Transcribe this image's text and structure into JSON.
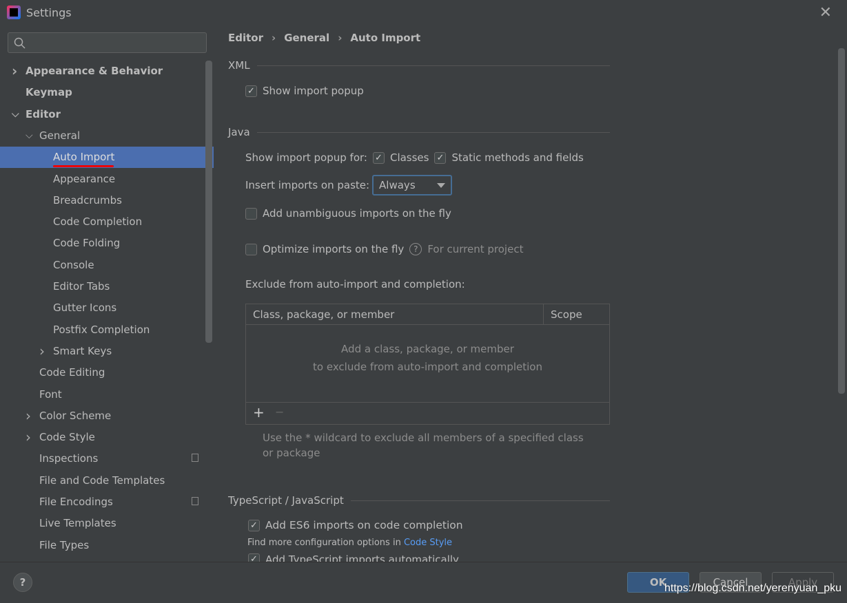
{
  "window": {
    "title": "Settings",
    "close_icon": "close-icon"
  },
  "search": {
    "placeholder": ""
  },
  "sidebar": {
    "items": [
      {
        "label": "Appearance & Behavior",
        "level": 0,
        "bold": true,
        "arrow": "right"
      },
      {
        "label": "Keymap",
        "level": 0,
        "bold": true,
        "arrow": ""
      },
      {
        "label": "Editor",
        "level": 0,
        "bold": true,
        "arrow": "down"
      },
      {
        "label": "General",
        "level": 1,
        "arrow": "down"
      },
      {
        "label": "Auto Import",
        "level": 2,
        "selected": true,
        "arrow": ""
      },
      {
        "label": "Appearance",
        "level": 2,
        "arrow": ""
      },
      {
        "label": "Breadcrumbs",
        "level": 2,
        "arrow": ""
      },
      {
        "label": "Code Completion",
        "level": 2,
        "arrow": ""
      },
      {
        "label": "Code Folding",
        "level": 2,
        "arrow": ""
      },
      {
        "label": "Console",
        "level": 2,
        "arrow": ""
      },
      {
        "label": "Editor Tabs",
        "level": 2,
        "arrow": ""
      },
      {
        "label": "Gutter Icons",
        "level": 2,
        "arrow": ""
      },
      {
        "label": "Postfix Completion",
        "level": 2,
        "arrow": ""
      },
      {
        "label": "Smart Keys",
        "level": 2,
        "arrow": "right"
      },
      {
        "label": "Code Editing",
        "level": 1,
        "arrow": ""
      },
      {
        "label": "Font",
        "level": 1,
        "arrow": ""
      },
      {
        "label": "Color Scheme",
        "level": 1,
        "arrow": "right"
      },
      {
        "label": "Code Style",
        "level": 1,
        "arrow": "right"
      },
      {
        "label": "Inspections",
        "level": 1,
        "arrow": "",
        "project_icon": true
      },
      {
        "label": "File and Code Templates",
        "level": 1,
        "arrow": ""
      },
      {
        "label": "File Encodings",
        "level": 1,
        "arrow": "",
        "project_icon": true
      },
      {
        "label": "Live Templates",
        "level": 1,
        "arrow": ""
      },
      {
        "label": "File Types",
        "level": 1,
        "arrow": ""
      }
    ]
  },
  "breadcrumb": [
    "Editor",
    "General",
    "Auto Import"
  ],
  "xml": {
    "header": "XML",
    "show_popup": {
      "label": "Show import popup",
      "checked": true
    }
  },
  "java": {
    "header": "Java",
    "popup_for_label": "Show import popup for:",
    "classes": {
      "label": "Classes",
      "checked": true
    },
    "static": {
      "label": "Static methods and fields",
      "checked": true
    },
    "paste_label": "Insert imports on paste:",
    "paste_value": "Always",
    "unambiguous": {
      "label": "Add unambiguous imports on the fly",
      "checked": false
    },
    "optimize": {
      "label": "Optimize imports on the fly",
      "checked": false
    },
    "optimize_note": "For current project",
    "exclude_label": "Exclude from auto-import and completion:",
    "table": {
      "columns": [
        "Class, package, or member",
        "Scope"
      ],
      "empty_line1": "Add a class, package, or member",
      "empty_line2": "to exclude from auto-import and completion",
      "add": "+",
      "remove": "−"
    },
    "hint": "Use the * wildcard to exclude all members of a specified class or package"
  },
  "ts": {
    "header": "TypeScript / JavaScript",
    "es6": {
      "label": "Add ES6 imports on code completion",
      "checked": true
    },
    "more_text": "Find more configuration options in ",
    "more_link": "Code Style",
    "ts_auto": {
      "label": "Add TypeScript imports automatically",
      "checked": true
    }
  },
  "footer": {
    "help": "?",
    "ok": "OK",
    "cancel": "Cancel",
    "apply": "Apply"
  },
  "watermark": "https://blog.csdn.net/yerenyuan_pku",
  "colors": {
    "selection": "#4b6eaf",
    "ok_button": "#365880",
    "link": "#589df6",
    "background": "#3c3f41"
  }
}
